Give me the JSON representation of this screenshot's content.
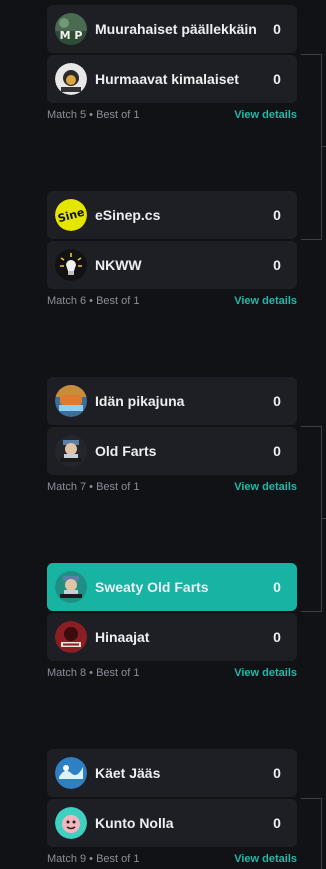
{
  "colors": {
    "background": "#111216",
    "card": "#1e1f25",
    "highlight": "#17b3a3",
    "accent_link": "#23b7a8",
    "meta_text": "#8a8e97"
  },
  "matches": [
    {
      "label": "Match 5 • Best of 1",
      "details_link": "View details",
      "teams": [
        {
          "name": "Muurahaiset päällekkäin",
          "score": "0",
          "logo": "muurahaiset-logo"
        },
        {
          "name": "Hurmaavat kimalaiset",
          "score": "0",
          "logo": "kimalaiset-logo"
        }
      ]
    },
    {
      "label": "Match 6 • Best of 1",
      "details_link": "View details",
      "teams": [
        {
          "name": "eSinep.cs",
          "score": "0",
          "logo": "esinep-logo"
        },
        {
          "name": "NKWW",
          "score": "0",
          "logo": "nkww-logo"
        }
      ]
    },
    {
      "label": "Match 7 • Best of 1",
      "details_link": "View details",
      "teams": [
        {
          "name": "Idän pikajuna",
          "score": "0",
          "logo": "idan-pikajuna-logo"
        },
        {
          "name": "Old Farts",
          "score": "0",
          "logo": "old-farts-logo"
        }
      ]
    },
    {
      "label": "Match 8 • Best of 1",
      "details_link": "View details",
      "teams": [
        {
          "name": "Sweaty Old Farts",
          "score": "0",
          "logo": "sweaty-old-farts-logo",
          "highlighted": true
        },
        {
          "name": "Hinaajat",
          "score": "0",
          "logo": "hinaajat-logo"
        }
      ]
    },
    {
      "label": "Match 9 • Best of 1",
      "details_link": "View details",
      "teams": [
        {
          "name": "Käet Jääs",
          "score": "0",
          "logo": "kaet-jaas-logo"
        },
        {
          "name": "Kunto Nolla",
          "score": "0",
          "logo": "kunto-nolla-logo"
        }
      ]
    }
  ]
}
